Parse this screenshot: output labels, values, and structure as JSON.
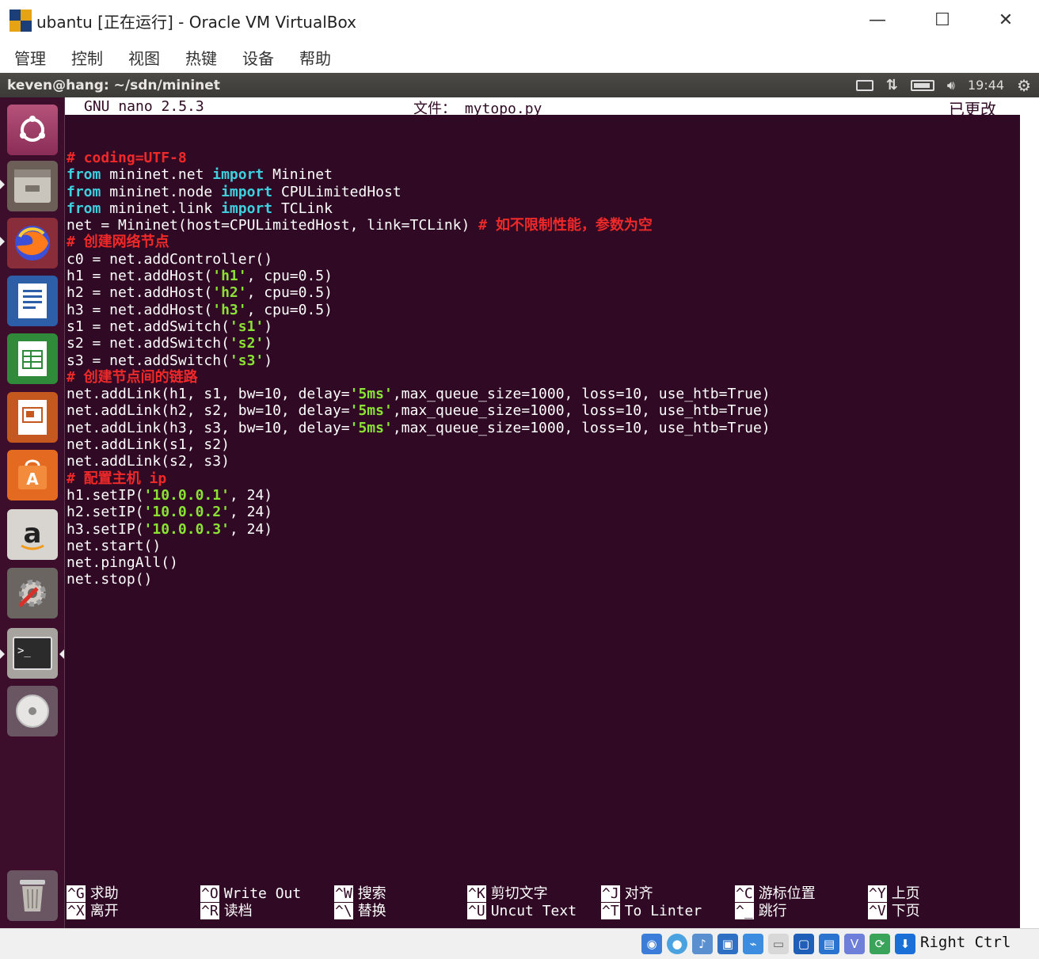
{
  "window": {
    "title": "ubantu [正在运行] - Oracle VM VirtualBox",
    "minimize": "—",
    "maximize": "☐",
    "close": "✕"
  },
  "menu": [
    "管理",
    "控制",
    "视图",
    "热键",
    "设备",
    "帮助"
  ],
  "panel": {
    "title": "keven@hang: ~/sdn/mininet",
    "time": "19:44"
  },
  "launcher": {
    "icons": [
      "ubuntu-dash-icon",
      "files-icon",
      "firefox-icon",
      "writer-icon",
      "calc-icon",
      "impress-icon",
      "software-center-icon",
      "amazon-icon",
      "system-settings-icon",
      "terminal-icon",
      "dvd-icon",
      "trash-icon"
    ]
  },
  "nano": {
    "version": "GNU nano 2.5.3",
    "file_label": "文件：",
    "file_name": "mytopo.py",
    "modified": "已更改"
  },
  "code_lines": [
    [
      {
        "t": "# coding=UTF-8",
        "c": "cm"
      }
    ],
    [
      {
        "t": "from",
        "c": "kw"
      },
      {
        "t": " mininet.net "
      },
      {
        "t": "import",
        "c": "kw"
      },
      {
        "t": " Mininet"
      }
    ],
    [
      {
        "t": "from",
        "c": "kw"
      },
      {
        "t": " mininet.node "
      },
      {
        "t": "import",
        "c": "kw"
      },
      {
        "t": " CPULimitedHost"
      }
    ],
    [
      {
        "t": "from",
        "c": "kw"
      },
      {
        "t": " mininet.link "
      },
      {
        "t": "import",
        "c": "kw"
      },
      {
        "t": " TCLink"
      }
    ],
    [
      {
        "t": "net = Mininet(host=CPULimitedHost, link=TCLink) "
      },
      {
        "t": "# 如不限制性能，参数为空",
        "c": "cm"
      }
    ],
    [
      {
        "t": "# 创建网络节点",
        "c": "cm"
      }
    ],
    [
      {
        "t": "c0 = net.addController()"
      }
    ],
    [
      {
        "t": "h1 = net.addHost("
      },
      {
        "t": "'h1'",
        "c": "str"
      },
      {
        "t": ", cpu=0.5)"
      }
    ],
    [
      {
        "t": "h2 = net.addHost("
      },
      {
        "t": "'h2'",
        "c": "str"
      },
      {
        "t": ", cpu=0.5)"
      }
    ],
    [
      {
        "t": "h3 = net.addHost("
      },
      {
        "t": "'h3'",
        "c": "str"
      },
      {
        "t": ", cpu=0.5)"
      }
    ],
    [
      {
        "t": "s1 = net.addSwitch("
      },
      {
        "t": "'s1'",
        "c": "str"
      },
      {
        "t": ")"
      }
    ],
    [
      {
        "t": "s2 = net.addSwitch("
      },
      {
        "t": "'s2'",
        "c": "str"
      },
      {
        "t": ")"
      }
    ],
    [
      {
        "t": "s3 = net.addSwitch("
      },
      {
        "t": "'s3'",
        "c": "str"
      },
      {
        "t": ")"
      }
    ],
    [
      {
        "t": "# 创建节点间的链路",
        "c": "cm"
      }
    ],
    [
      {
        "t": "net.addLink(h1, s1, bw=10, delay="
      },
      {
        "t": "'5ms'",
        "c": "str"
      },
      {
        "t": ",max_queue_size=1000, loss=10, use_htb=True)"
      }
    ],
    [
      {
        "t": "net.addLink(h2, s2, bw=10, delay="
      },
      {
        "t": "'5ms'",
        "c": "str"
      },
      {
        "t": ",max_queue_size=1000, loss=10, use_htb=True)"
      }
    ],
    [
      {
        "t": "net.addLink(h3, s3, bw=10, delay="
      },
      {
        "t": "'5ms'",
        "c": "str"
      },
      {
        "t": ",max_queue_size=1000, loss=10, use_htb=True)"
      }
    ],
    [
      {
        "t": "net.addLink(s1, s2)"
      }
    ],
    [
      {
        "t": "net.addLink(s2, s3)"
      }
    ],
    [
      {
        "t": "# 配置主机 ip",
        "c": "cm"
      }
    ],
    [
      {
        "t": "h1.setIP("
      },
      {
        "t": "'10.0.0.1'",
        "c": "str"
      },
      {
        "t": ", 24)"
      }
    ],
    [
      {
        "t": "h2.setIP("
      },
      {
        "t": "'10.0.0.2'",
        "c": "str"
      },
      {
        "t": ", 24)"
      }
    ],
    [
      {
        "t": "h3.setIP("
      },
      {
        "t": "'10.0.0.3'",
        "c": "str"
      },
      {
        "t": ", 24)"
      }
    ],
    [
      {
        "t": "net.start()"
      }
    ],
    [
      {
        "t": "net.pingAll()"
      }
    ],
    [
      {
        "t": "net.stop()"
      }
    ]
  ],
  "shortcuts": [
    {
      "k1": "^G",
      "l1": "求助",
      "k2": "^X",
      "l2": "离开"
    },
    {
      "k1": "^O",
      "l1": "Write Out",
      "k2": "^R",
      "l2": "读档"
    },
    {
      "k1": "^W",
      "l1": "搜索",
      "k2": "^\\",
      "l2": "替换"
    },
    {
      "k1": "^K",
      "l1": "剪切文字",
      "k2": "^U",
      "l2": "Uncut Text"
    },
    {
      "k1": "^J",
      "l1": "对齐",
      "k2": "^T",
      "l2": "To Linter"
    },
    {
      "k1": "^C",
      "l1": "游标位置",
      "k2": "^_",
      "l2": "跳行"
    },
    {
      "k1": "^Y",
      "l1": "上页",
      "k2": "^V",
      "l2": "下页"
    }
  ],
  "status": {
    "host_key": "Right Ctrl"
  },
  "colors": {
    "terminal_bg": "#300a24",
    "keyword": "#3fd0e0",
    "string": "#8ae234",
    "comment": "#ef2929"
  }
}
